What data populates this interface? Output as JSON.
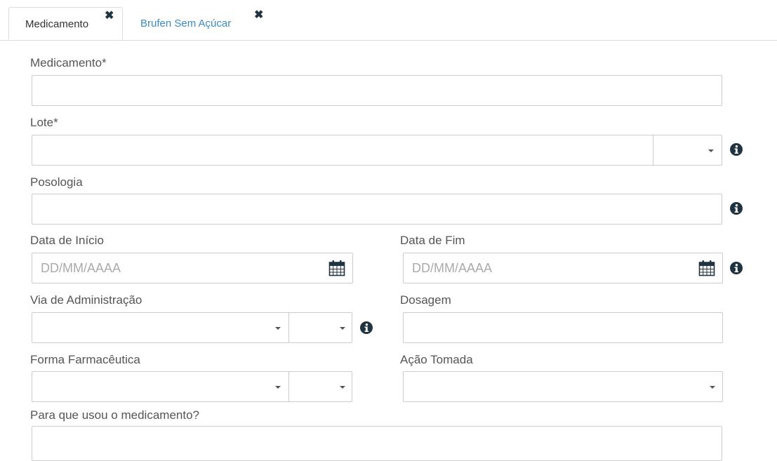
{
  "tabs": [
    {
      "label": "Medicamento",
      "active": true
    },
    {
      "label": "Brufen Sem Açúcar",
      "active": false
    }
  ],
  "form": {
    "medicamento_label": "Medicamento*",
    "lote_label": "Lote*",
    "posologia_label": "Posologia",
    "data_inicio_label": "Data de Início",
    "data_inicio_placeholder": "DD/MM/AAAA",
    "data_fim_label": "Data de Fim",
    "data_fim_placeholder": "DD/MM/AAAA",
    "via_label": "Via de Administração",
    "dosagem_label": "Dosagem",
    "forma_label": "Forma Farmacêutica",
    "acao_label": "Ação Tomada",
    "para_que_label": "Para que usou o medicamento?"
  },
  "colors": {
    "accent_link": "#3a8bc4",
    "icon_dark": "#1f3340",
    "border": "#cccccc"
  },
  "icons": {
    "close": "close-icon",
    "info": "info-icon",
    "calendar": "calendar-icon",
    "dropdown": "chevron-down-icon"
  }
}
